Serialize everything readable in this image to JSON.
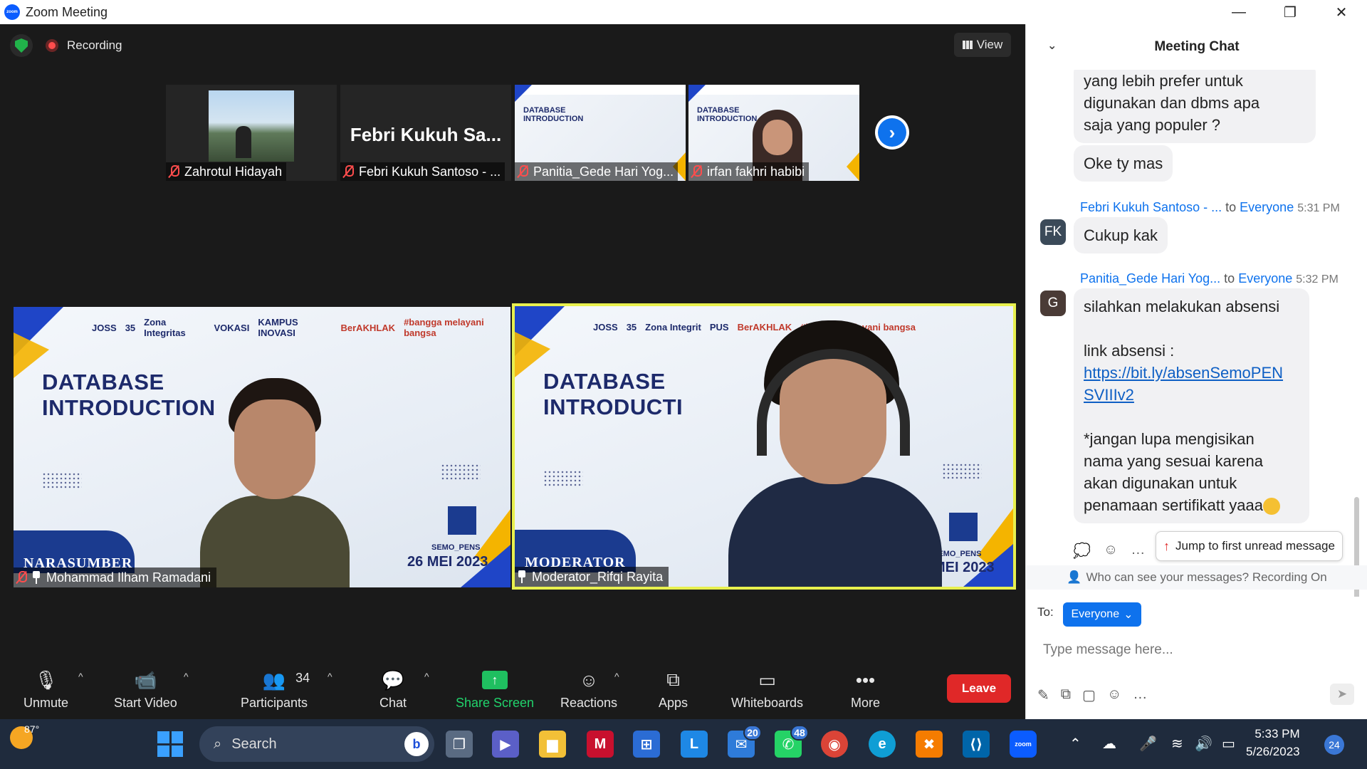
{
  "window": {
    "title": "Zoom Meeting",
    "logo": "zoom",
    "minimize": "—",
    "maximize": "❐",
    "close": "✕"
  },
  "meeting": {
    "recording_label": "Recording",
    "view_label": "View",
    "thumbnails": [
      {
        "name": "Zahrotul Hidayah"
      },
      {
        "name": "Febri Kukuh Santoso - ...",
        "big_name": "Febri Kukuh Sa..."
      },
      {
        "name": "Panitia_Gede Hari Yog...",
        "slide_title": "DATABASE INTRODUCTION"
      },
      {
        "name": "irfan fakhri habibi",
        "slide_title": "DATABASE INTRODUCTION"
      }
    ],
    "tiles": [
      {
        "name": "Mohammad Ilham Ramadani",
        "slide_heading_1": "DATABASE",
        "slide_heading_2": "INTRODUCTION",
        "role": "NARASUMBER",
        "event": "SEMO_PENS",
        "date": "26 MEI 2023",
        "logos": [
          "JOSS",
          "35",
          "Zona Integritas",
          "VOKASI",
          "KAMPUS INOVASI",
          "BerAKHLAK",
          "#bangga melayani bangsa"
        ]
      },
      {
        "name": "Moderator_Rifqi Rayita",
        "slide_heading_1": "DATABASE",
        "slide_heading_2": "INTRODUCTI",
        "role": "MODERATOR",
        "event": "SEMO_PENS",
        "date": "MEI 2023",
        "logos": [
          "JOSS",
          "35",
          "Zona Integrit",
          "PUS",
          "BerAKHLAK",
          "#bangga melayani bangsa"
        ]
      }
    ]
  },
  "toolbar": {
    "unmute": "Unmute",
    "start_video": "Start Video",
    "participants": "Participants",
    "participants_count": "34",
    "chat": "Chat",
    "share_screen": "Share Screen",
    "reactions": "Reactions",
    "apps": "Apps",
    "whiteboards": "Whiteboards",
    "more": "More",
    "leave": "Leave"
  },
  "chat": {
    "title": "Meeting Chat",
    "messages": [
      {
        "text_lines": [
          "yang lebih prefer untuk",
          "digunakan dan dbms apa",
          "saja yang populer ?"
        ]
      },
      {
        "text": "Oke ty mas"
      },
      {
        "sender": "Febri Kukuh Santoso - ...",
        "to_label": "to",
        "recipient": "Everyone",
        "time": "5:31 PM",
        "initials": "FK",
        "text": "Cukup kak"
      },
      {
        "sender": "Panitia_Gede Hari Yog...",
        "to_label": "to",
        "recipient": "Everyone",
        "time": "5:32 PM",
        "initials": "G",
        "line1": "silahkan melakukan absensi",
        "line2": "link absensi :",
        "link_1": "https://bit.ly/absenSemoPEN",
        "link_2": "SVIIIv2",
        "line3": "*jangan lupa mengisikan",
        "line4": "nama yang sesuai karena",
        "line5": "akan digunakan untuk",
        "line6": "penamaan sertifikatt yaaa"
      }
    ],
    "jump_label": "Jump to first unread message",
    "who_can_see": "Who can see your messages? Recording On",
    "to_label": "To:",
    "recipient_button": "Everyone",
    "input_placeholder": "Type message here..."
  },
  "taskbar": {
    "weather_temp": "87°",
    "search_label": "Search",
    "mail_badge": "20",
    "whatsapp_badge": "48",
    "time": "5:33 PM",
    "date": "5/26/2023",
    "notification_count": "24"
  }
}
